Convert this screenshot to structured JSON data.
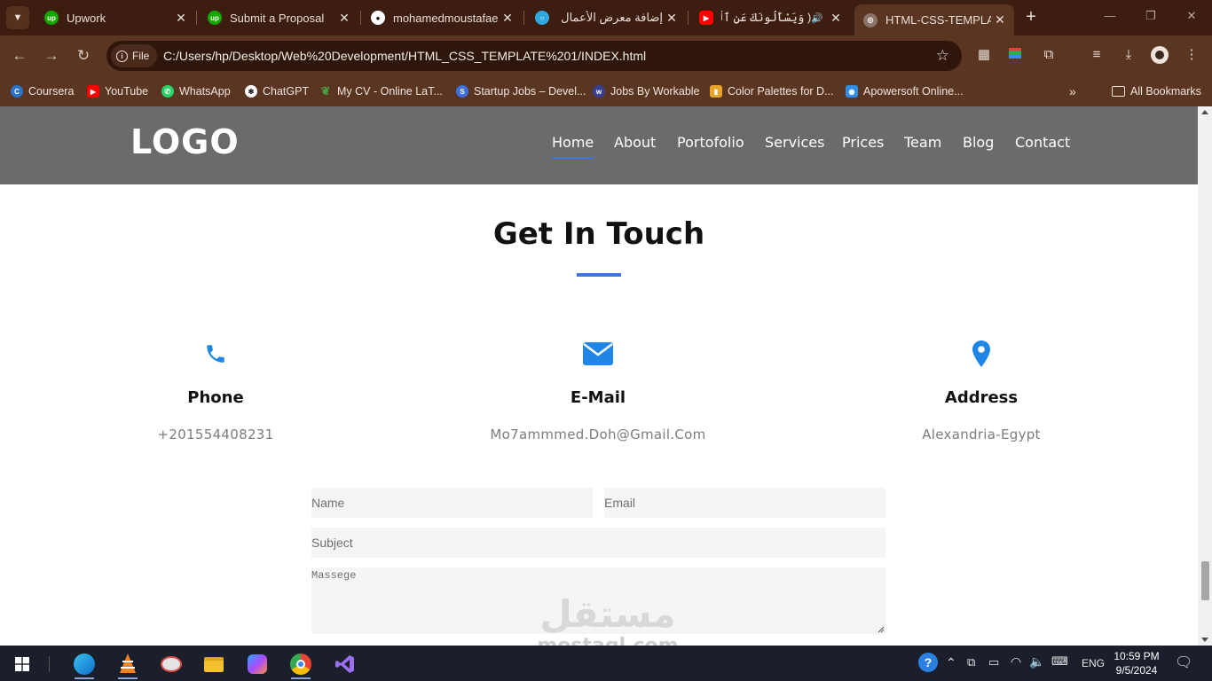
{
  "browser": {
    "tabs": [
      {
        "title": "Upwork",
        "icon": "upwork-icon",
        "color": "#14a800"
      },
      {
        "title": "Submit a Proposal",
        "icon": "upwork-icon",
        "color": "#14a800"
      },
      {
        "title": "mohamedmoustafaeg",
        "icon": "github-icon",
        "color": "#ffffff"
      },
      {
        "title": "إضافة معرض الأعمال",
        "icon": "mostaql-icon",
        "color": "#2fa8e0"
      },
      {
        "title": "( وَيَسْأَلُونَكَ عَنِ ٱلْجِ",
        "icon": "youtube-icon",
        "color": "#ff0000"
      },
      {
        "title": "HTML-CSS-TEMPLATE",
        "icon": "globe-icon",
        "color": "#c8b8ae"
      }
    ],
    "site_chip": "File",
    "url": "C:/Users/hp/Desktop/Web%20Development/HTML_CSS_TEMPLATE%201/INDEX.html",
    "bookmarks": [
      {
        "label": "Coursera",
        "icon": "coursera-icon",
        "color": "#2a73cc"
      },
      {
        "label": "YouTube",
        "icon": "youtube-icon",
        "color": "#ff0000"
      },
      {
        "label": "WhatsApp",
        "icon": "whatsapp-icon",
        "color": "#25d366"
      },
      {
        "label": "ChatGPT",
        "icon": "chatgpt-icon",
        "color": "#ffffff"
      },
      {
        "label": "My CV - Online LaT...",
        "icon": "overleaf-icon",
        "color": "#47a141"
      },
      {
        "label": "Startup Jobs – Devel...",
        "icon": "startup-jobs-icon",
        "color": "#3e6fe1"
      },
      {
        "label": "Jobs By Workable",
        "icon": "workable-icon",
        "color": "#3b3f8f"
      },
      {
        "label": "Color Palettes for D...",
        "icon": "palette-icon",
        "color": "#e8a32a"
      },
      {
        "label": "Apowersoft Online...",
        "icon": "apowersoft-icon",
        "color": "#2f8ee8"
      }
    ],
    "all_bookmarks": "All Bookmarks"
  },
  "site": {
    "logo": "LOGO",
    "nav": [
      "Home",
      "About",
      "Portofolio",
      "Services",
      "Prices",
      "Team",
      "Blog",
      "Contact"
    ],
    "active_nav": "Home",
    "accent": "#3f74e6",
    "section_title": "Get In Touch",
    "contacts": [
      {
        "icon": "phone-icon",
        "title": "Phone",
        "value": "+201554408231"
      },
      {
        "icon": "envelope-icon",
        "title": "E-Mail",
        "value": "Mo7ammmed.Doh@Gmail.Com"
      },
      {
        "icon": "map-pin-icon",
        "title": "Address",
        "value": "Alexandria-Egypt"
      }
    ],
    "form": {
      "name_placeholder": "Name",
      "email_placeholder": "Email",
      "subject_placeholder": "Subject",
      "message_placeholder": "Massege"
    },
    "watermark_ar": "مستقل",
    "watermark_en": "mostaql.com"
  },
  "taskbar": {
    "language": "ENG",
    "time": "10:59 PM",
    "date": "9/5/2024"
  }
}
